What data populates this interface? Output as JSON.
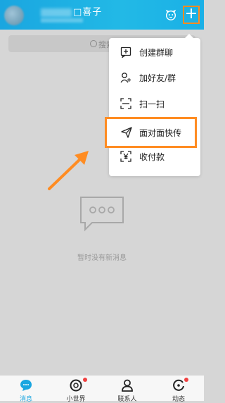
{
  "header": {
    "username": "□喜子",
    "plus_glyph": "+",
    "pet_icon": "dog-face-icon"
  },
  "search": {
    "placeholder": "搜索"
  },
  "menu": {
    "items": [
      {
        "label": "创建群聊",
        "icon": "create-group-icon"
      },
      {
        "label": "加好友/群",
        "icon": "add-friend-icon"
      },
      {
        "label": "扫一扫",
        "icon": "scan-icon"
      },
      {
        "label": "面对面快传",
        "icon": "send-icon"
      },
      {
        "label": "收付款",
        "icon": "payment-icon"
      }
    ]
  },
  "empty": {
    "text": "暂时没有新消息"
  },
  "tabs": [
    {
      "label": "消息",
      "active": true
    },
    {
      "label": "小世界",
      "active": false
    },
    {
      "label": "联系人",
      "active": false
    },
    {
      "label": "动态",
      "active": false
    }
  ],
  "colors": {
    "accent": "#1aa6e0",
    "highlight": "#ff8c22",
    "background": "#d6d6d6"
  }
}
